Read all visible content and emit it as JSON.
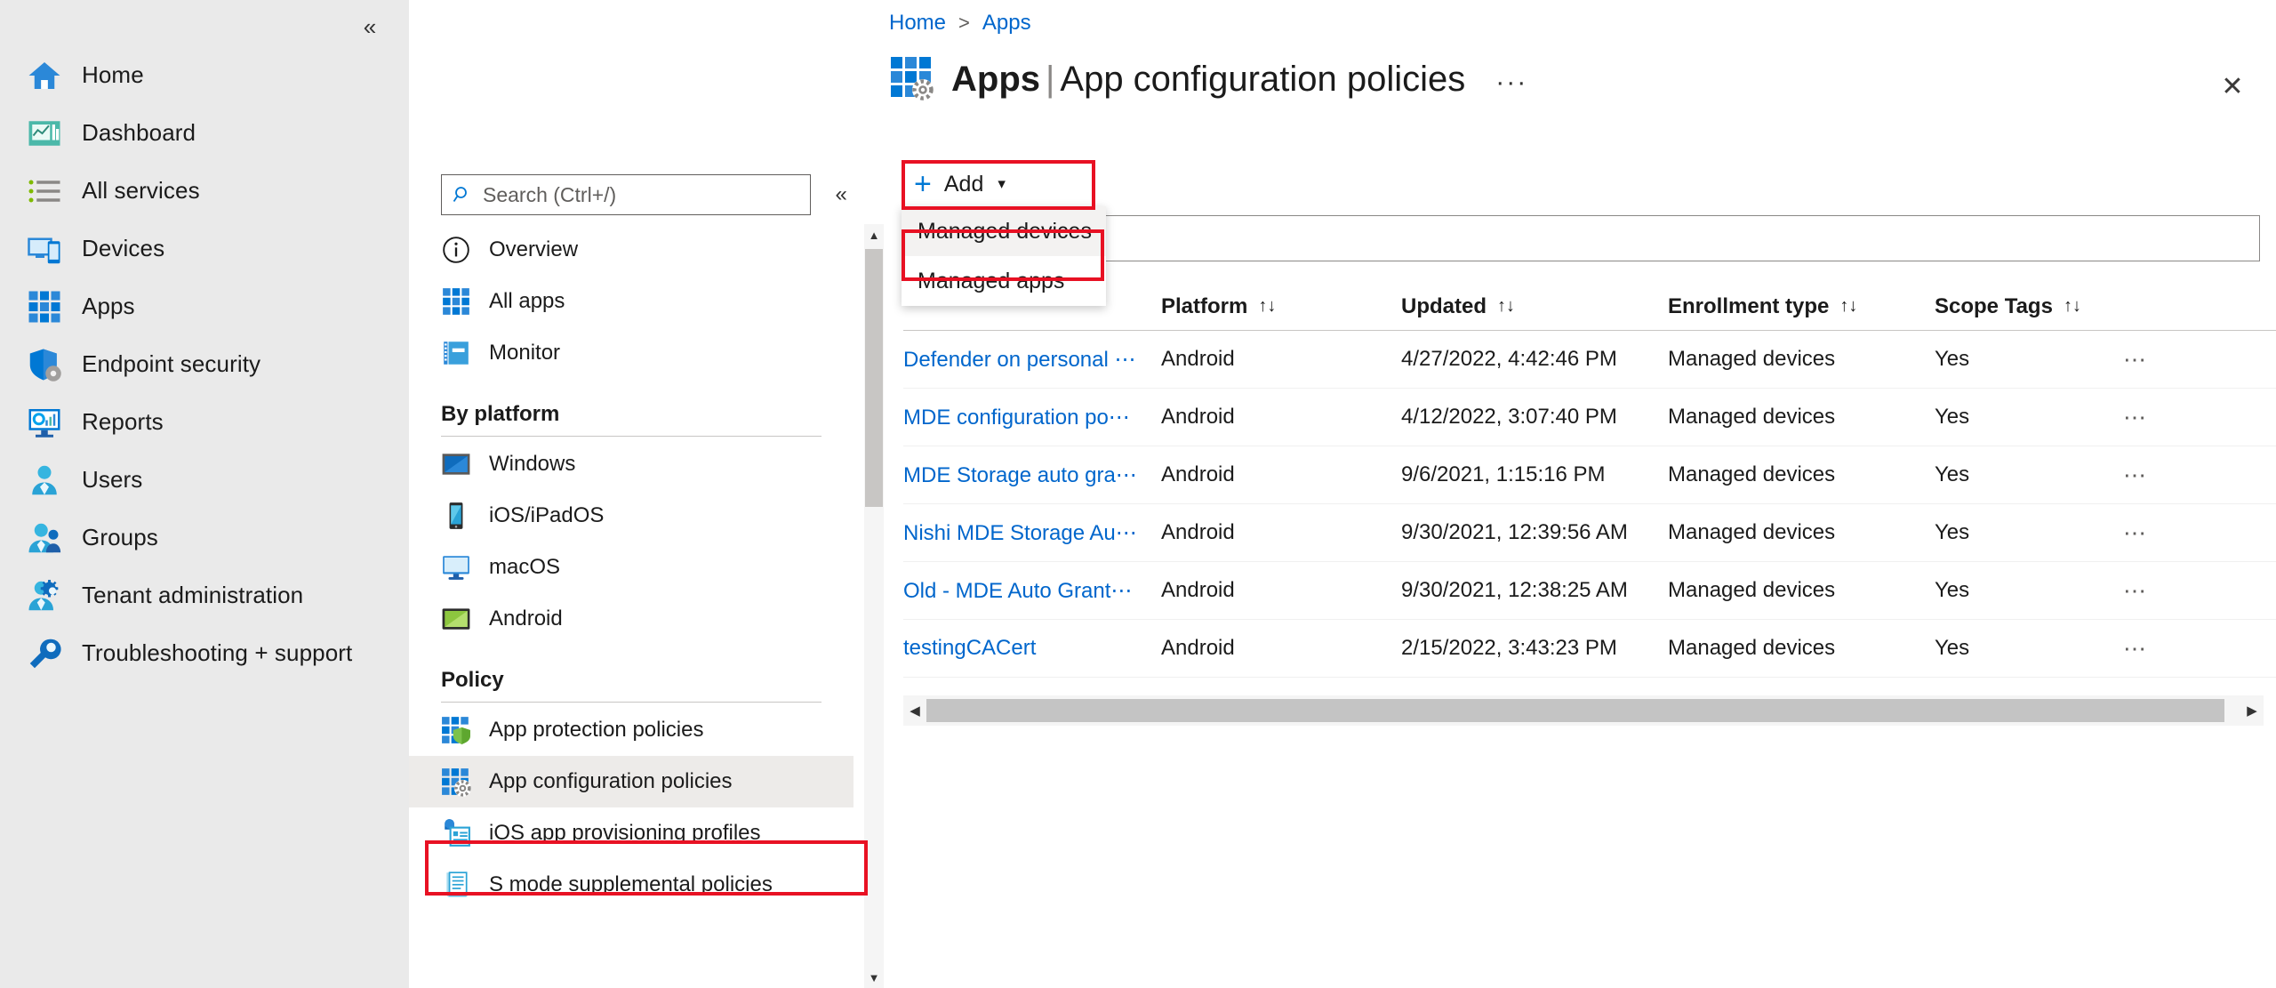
{
  "left_rail": {
    "collapse_icon": "chevron-double-left-icon",
    "items": [
      {
        "label": "Home",
        "icon": "home-icon"
      },
      {
        "label": "Dashboard",
        "icon": "dashboard-icon"
      },
      {
        "label": "All services",
        "icon": "all-services-icon"
      },
      {
        "label": "Devices",
        "icon": "devices-icon"
      },
      {
        "label": "Apps",
        "icon": "apps-grid-icon"
      },
      {
        "label": "Endpoint security",
        "icon": "shield-gear-icon"
      },
      {
        "label": "Reports",
        "icon": "reports-monitor-icon"
      },
      {
        "label": "Users",
        "icon": "user-icon"
      },
      {
        "label": "Groups",
        "icon": "groups-icon"
      },
      {
        "label": "Tenant administration",
        "icon": "user-gear-icon"
      },
      {
        "label": "Troubleshooting + support",
        "icon": "wrench-icon"
      }
    ]
  },
  "mid_panel": {
    "search": {
      "placeholder": "Search (Ctrl+/)",
      "value": "",
      "icon": "search-icon"
    },
    "collapse_icon": "chevron-double-left-icon",
    "items": [
      {
        "label": "Overview",
        "icon": "info-circle-icon",
        "type": "item"
      },
      {
        "label": "All apps",
        "icon": "apps-grid-icon",
        "type": "item"
      },
      {
        "label": "Monitor",
        "icon": "monitor-book-icon",
        "type": "item"
      },
      {
        "label": "By platform",
        "type": "group"
      },
      {
        "label": "Windows",
        "icon": "windows-icon",
        "type": "item"
      },
      {
        "label": "iOS/iPadOS",
        "icon": "ios-device-icon",
        "type": "item"
      },
      {
        "label": "macOS",
        "icon": "macos-display-icon",
        "type": "item"
      },
      {
        "label": "Android",
        "icon": "android-screen-icon",
        "type": "item"
      },
      {
        "label": "Policy",
        "type": "group"
      },
      {
        "label": "App protection policies",
        "icon": "app-protection-icon",
        "type": "item"
      },
      {
        "label": "App configuration policies",
        "icon": "app-config-icon",
        "type": "item",
        "selected": true
      },
      {
        "label": "iOS app provisioning profiles",
        "icon": "ios-provisioning-icon",
        "type": "item"
      },
      {
        "label": "S mode supplemental policies",
        "icon": "s-mode-icon",
        "type": "item"
      }
    ],
    "scroll_up_icon": "triangle-up-icon",
    "scroll_down_icon": "triangle-down-icon"
  },
  "header": {
    "breadcrumb": [
      "Home",
      "Apps"
    ],
    "breadcrumb_separator": ">",
    "title_service": "Apps",
    "title_divider": "|",
    "title_page": "App configuration policies",
    "ellipsis": "···",
    "close_icon": "close-icon",
    "page_icon": "app-config-icon"
  },
  "command_bar": {
    "add_label": "Add",
    "add_plus": "+",
    "add_chevron": "chevron-down-icon",
    "dropdown": [
      {
        "label": "Managed devices",
        "hover": true
      },
      {
        "label": "Managed apps",
        "hover": false
      }
    ]
  },
  "filter": {
    "value": "",
    "placeholder": ""
  },
  "table": {
    "columns": [
      {
        "key": "name",
        "label": "",
        "sort": ""
      },
      {
        "key": "platform",
        "label": "Platform",
        "sort": "↑↓"
      },
      {
        "key": "updated",
        "label": "Updated",
        "sort": "↑↓"
      },
      {
        "key": "enrollment",
        "label": "Enrollment type",
        "sort": "↑↓"
      },
      {
        "key": "scope",
        "label": "Scope Tags",
        "sort": "↑↓"
      },
      {
        "key": "actions",
        "label": "",
        "sort": ""
      }
    ],
    "rows": [
      {
        "name": "Defender on personal ⋯",
        "platform": "Android",
        "updated": "4/27/2022, 4:42:46 PM",
        "enrollment": "Managed devices",
        "scope": "Yes",
        "actions": "⋯"
      },
      {
        "name": "MDE configuration po⋯",
        "platform": "Android",
        "updated": "4/12/2022, 3:07:40 PM",
        "enrollment": "Managed devices",
        "scope": "Yes",
        "actions": "⋯"
      },
      {
        "name": "MDE Storage auto gra⋯",
        "platform": "Android",
        "updated": "9/6/2021, 1:15:16 PM",
        "enrollment": "Managed devices",
        "scope": "Yes",
        "actions": "⋯"
      },
      {
        "name": "Nishi MDE Storage Au⋯",
        "platform": "Android",
        "updated": "9/30/2021, 12:39:56 AM",
        "enrollment": "Managed devices",
        "scope": "Yes",
        "actions": "⋯"
      },
      {
        "name": "Old - MDE Auto Grant⋯",
        "platform": "Android",
        "updated": "9/30/2021, 12:38:25 AM",
        "enrollment": "Managed devices",
        "scope": "Yes",
        "actions": "⋯"
      },
      {
        "name": "testingCACert",
        "platform": "Android",
        "updated": "2/15/2022, 3:43:23 PM",
        "enrollment": "Managed devices",
        "scope": "Yes",
        "actions": "⋯"
      }
    ],
    "hscroll_left_icon": "triangle-left-icon",
    "hscroll_right_icon": "triangle-right-icon"
  },
  "colors": {
    "accent": "#0078d4",
    "link": "#0066cc",
    "highlight": "#e81123",
    "rail_bg": "#eaeaea",
    "selected_bg": "#edebe9"
  }
}
